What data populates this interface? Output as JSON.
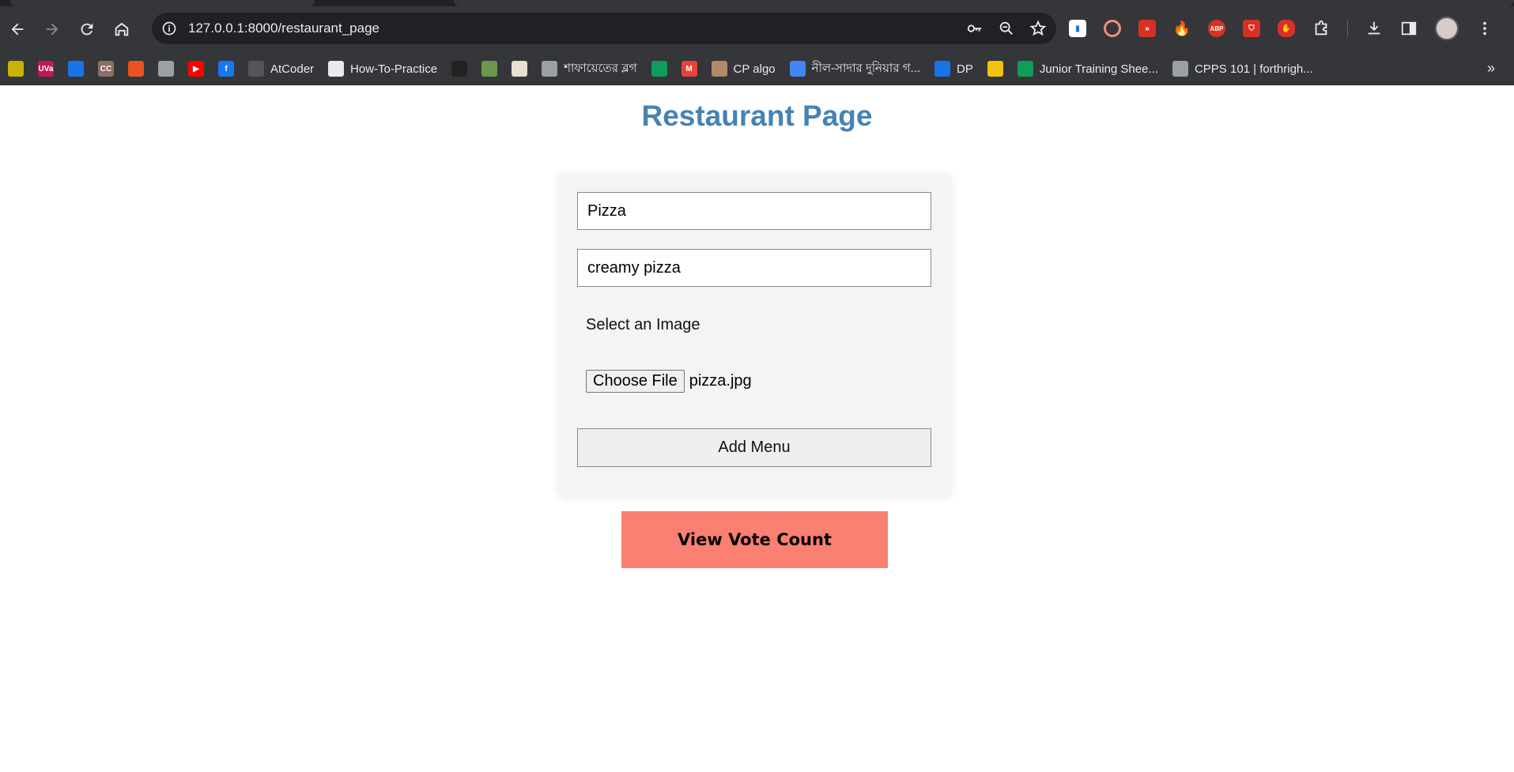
{
  "browser": {
    "url_host": "127.0.0.1",
    "url_rest": ":8000/restaurant_page",
    "bookmarks": [
      {
        "label": "",
        "color": "#c8b400",
        "glyph": ""
      },
      {
        "label": "",
        "color": "#c2185b",
        "glyph": "UVa"
      },
      {
        "label": "",
        "color": "#1a73e8",
        "glyph": ""
      },
      {
        "label": "",
        "color": "#8d6e63",
        "glyph": "CC"
      },
      {
        "label": "",
        "color": "#e95420",
        "glyph": ""
      },
      {
        "label": "",
        "color": "#9aa0a6",
        "glyph": ""
      },
      {
        "label": "",
        "color": "#ff0000",
        "glyph": "▶"
      },
      {
        "label": "",
        "color": "#1877f2",
        "glyph": "f"
      },
      {
        "label": "AtCoder",
        "color": "#555555",
        "glyph": ""
      },
      {
        "label": "How-To-Practice",
        "color": "#e8eaed",
        "glyph": ""
      },
      {
        "label": "",
        "color": "#222222",
        "glyph": ""
      },
      {
        "label": "",
        "color": "#6a994e",
        "glyph": ""
      },
      {
        "label": "",
        "color": "#e8e0d0",
        "glyph": ""
      },
      {
        "label": "শাফায়েতের ব্লগ",
        "color": "#9aa0a6",
        "glyph": ""
      },
      {
        "label": "",
        "color": "#0f9d58",
        "glyph": ""
      },
      {
        "label": "",
        "color": "#ea4335",
        "glyph": "M"
      },
      {
        "label": "CP algo",
        "color": "#b08968",
        "glyph": ""
      },
      {
        "label": "নীল-সাদার দুনিয়ার গ...",
        "color": "#4285f4",
        "glyph": ""
      },
      {
        "label": "DP",
        "color": "#1a73e8",
        "glyph": ""
      },
      {
        "label": "",
        "color": "#f4c20d",
        "glyph": ""
      },
      {
        "label": "Junior Training Shee...",
        "color": "#0f9d58",
        "glyph": ""
      },
      {
        "label": "CPPS 101 | forthrigh...",
        "color": "#9aa0a6",
        "glyph": ""
      }
    ],
    "more_bookmarks": "»"
  },
  "page": {
    "title": "Restaurant Page",
    "menu_name_value": "Pizza",
    "menu_desc_value": "creamy pizza",
    "image_label": "Select an Image",
    "choose_file_label": "Choose File",
    "file_name": "pizza.jpg",
    "add_menu_label": "Add Menu",
    "view_vote_label": "View Vote Count"
  },
  "colors": {
    "title": "#4682b4",
    "vote_button": "#fa8072"
  }
}
